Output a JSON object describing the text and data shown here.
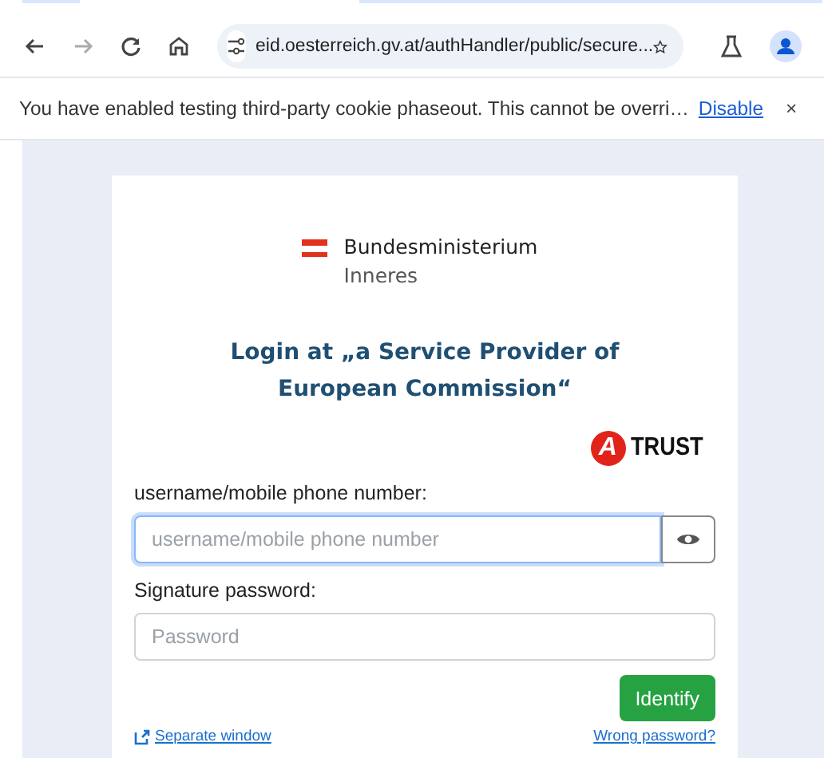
{
  "browser": {
    "url": "eid.oesterreich.gv.at/authHandler/public/secure..."
  },
  "infobar": {
    "message": "You have enabled testing third-party cookie phaseout. This cannot be overri…",
    "link": "Disable",
    "close": "×"
  },
  "login": {
    "ministry": {
      "line1": "Bundesministerium",
      "line2": "Inneres"
    },
    "heading": "Login at „a Service Provider of European Commission“",
    "trust_logo": {
      "letter": "A",
      "text": "TRUST"
    },
    "username": {
      "label": "username/mobile phone number:",
      "placeholder": "username/mobile phone number",
      "focused": true
    },
    "password": {
      "label": "Signature password:",
      "placeholder": "Password"
    },
    "submit": "Identify",
    "links": [
      {
        "kind": "window",
        "text": "Separate window"
      },
      {
        "kind": "plain",
        "text": "Wrong password?"
      }
    ]
  }
}
